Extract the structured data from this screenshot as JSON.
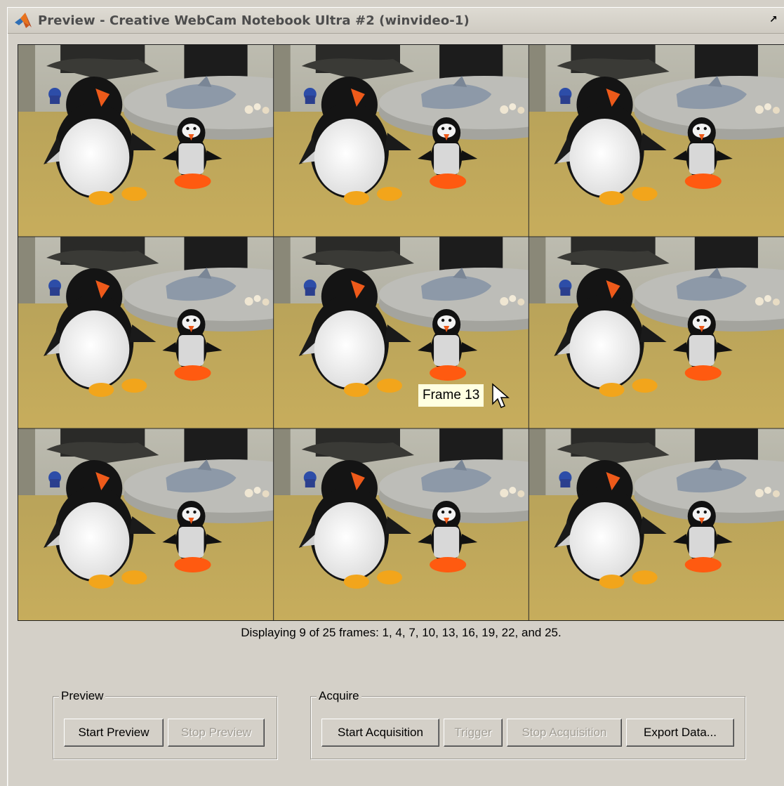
{
  "window": {
    "title": "Preview - Creative WebCam Notebook Ultra #2 (winvideo-1)",
    "app_icon": "matlab-logo-icon",
    "restore_icon": "restore-arrow-icon"
  },
  "display": {
    "rows": 3,
    "columns": 3,
    "frames": [
      1,
      4,
      7,
      10,
      13,
      16,
      19,
      22,
      25
    ],
    "tooltip": "Frame 13",
    "status": "Displaying 9 of 25 frames: 1, 4, 7, 10, 13, 16, 19, 22, and 25."
  },
  "preview_group": {
    "label": "Preview",
    "start_label": "Start Preview",
    "stop_label": "Stop Preview",
    "stop_enabled": false
  },
  "acquire_group": {
    "label": "Acquire",
    "start_label": "Start Acquisition",
    "trigger_label": "Trigger",
    "stop_label": "Stop Acquisition",
    "export_label": "Export Data...",
    "trigger_enabled": false,
    "stop_enabled": false
  },
  "colors": {
    "window_bg": "#d4d0c8",
    "tooltip_bg": "#ffffe1",
    "disabled_text": "#a19d94"
  }
}
